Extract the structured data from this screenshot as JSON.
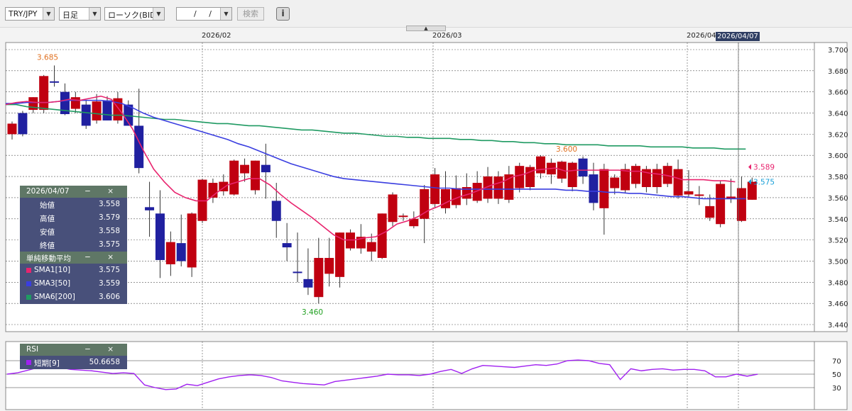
{
  "toolbar": {
    "symbol": "TRY/JPY",
    "timeframe": "日足",
    "chart_style": "ローソク(BID)",
    "date_input": "/ /",
    "search_label": "検索",
    "info_icon": "info-circle-icon",
    "collapse_icon": "triangle-up-icon"
  },
  "current_date_label": "2026/04/07",
  "ohlc_panel": {
    "title": "2026/04/07",
    "controls": "− ×",
    "rows": [
      {
        "label": "始値",
        "value": "3.558"
      },
      {
        "label": "高値",
        "value": "3.579"
      },
      {
        "label": "安値",
        "value": "3.558"
      },
      {
        "label": "終値",
        "value": "3.575"
      }
    ]
  },
  "sma_panel": {
    "title": "単純移動平均",
    "controls": "− ×",
    "rows": [
      {
        "label": "SMA1[10]",
        "value": "3.575",
        "color": "#e8246e"
      },
      {
        "label": "SMA3[50]",
        "value": "3.559",
        "color": "#3a3ee0"
      },
      {
        "label": "SMA6[200]",
        "value": "3.606",
        "color": "#1f9a62"
      }
    ]
  },
  "rsi_panel": {
    "title": "RSI",
    "controls": "− ×",
    "rows": [
      {
        "label": "短期[9]",
        "value": "50.6658",
        "color": "#a020f0"
      }
    ]
  },
  "colors": {
    "up": "#c00010",
    "down": "#2020a0",
    "sma10": "#e8246e",
    "sma50": "#3a3ee0",
    "sma200": "#1f9a62",
    "rsi": "#a020f0",
    "high_label": "#e07020",
    "low_label": "#20a020",
    "last_price": "#e8246e",
    "sma_price": "#1aa0d8"
  },
  "chart_data": {
    "type": "candlestick",
    "x_labels": [
      "2026/02",
      "2026/03",
      "2026/04"
    ],
    "ylim": [
      3.44,
      3.7
    ],
    "yticks": [
      "3.700",
      "3.680",
      "3.660",
      "3.640",
      "3.620",
      "3.600",
      "3.580",
      "3.560",
      "3.540",
      "3.520",
      "3.500",
      "3.480",
      "3.460",
      "3.440"
    ],
    "candles": [
      {
        "o": 3.62,
        "h": 3.632,
        "l": 3.615,
        "c": 3.63
      },
      {
        "o": 3.64,
        "h": 3.642,
        "l": 3.618,
        "c": 3.62
      },
      {
        "o": 3.643,
        "h": 3.655,
        "l": 3.64,
        "c": 3.655
      },
      {
        "o": 3.643,
        "h": 3.676,
        "l": 3.64,
        "c": 3.675
      },
      {
        "o": 3.67,
        "h": 3.685,
        "l": 3.665,
        "c": 3.669
      },
      {
        "o": 3.66,
        "h": 3.668,
        "l": 3.638,
        "c": 3.639
      },
      {
        "o": 3.644,
        "h": 3.66,
        "l": 3.64,
        "c": 3.655
      },
      {
        "o": 3.648,
        "h": 3.652,
        "l": 3.625,
        "c": 3.628
      },
      {
        "o": 3.633,
        "h": 3.658,
        "l": 3.63,
        "c": 3.651
      },
      {
        "o": 3.652,
        "h": 3.656,
        "l": 3.633,
        "c": 3.633
      },
      {
        "o": 3.633,
        "h": 3.66,
        "l": 3.63,
        "c": 3.654
      },
      {
        "o": 3.648,
        "h": 3.652,
        "l": 3.628,
        "c": 3.628
      },
      {
        "o": 3.628,
        "h": 3.663,
        "l": 3.583,
        "c": 3.588
      },
      {
        "o": 3.551,
        "h": 3.575,
        "l": 3.523,
        "c": 3.548
      },
      {
        "o": 3.545,
        "h": 3.567,
        "l": 3.484,
        "c": 3.501
      },
      {
        "o": 3.497,
        "h": 3.528,
        "l": 3.486,
        "c": 3.518
      },
      {
        "o": 3.517,
        "h": 3.544,
        "l": 3.495,
        "c": 3.5
      },
      {
        "o": 3.494,
        "h": 3.546,
        "l": 3.485,
        "c": 3.545
      },
      {
        "o": 3.538,
        "h": 3.578,
        "l": 3.536,
        "c": 3.577
      },
      {
        "o": 3.56,
        "h": 3.578,
        "l": 3.555,
        "c": 3.574
      },
      {
        "o": 3.566,
        "h": 3.582,
        "l": 3.562,
        "c": 3.575
      },
      {
        "o": 3.563,
        "h": 3.596,
        "l": 3.562,
        "c": 3.595
      },
      {
        "o": 3.583,
        "h": 3.597,
        "l": 3.575,
        "c": 3.591
      },
      {
        "o": 3.567,
        "h": 3.595,
        "l": 3.563,
        "c": 3.595
      },
      {
        "o": 3.591,
        "h": 3.611,
        "l": 3.559,
        "c": 3.584
      },
      {
        "o": 3.557,
        "h": 3.574,
        "l": 3.522,
        "c": 3.538
      },
      {
        "o": 3.517,
        "h": 3.536,
        "l": 3.5,
        "c": 3.513
      },
      {
        "o": 3.49,
        "h": 3.527,
        "l": 3.48,
        "c": 3.489
      },
      {
        "o": 3.483,
        "h": 3.512,
        "l": 3.468,
        "c": 3.475
      },
      {
        "o": 3.466,
        "h": 3.522,
        "l": 3.46,
        "c": 3.503
      },
      {
        "o": 3.488,
        "h": 3.522,
        "l": 3.476,
        "c": 3.503
      },
      {
        "o": 3.485,
        "h": 3.527,
        "l": 3.475,
        "c": 3.527
      },
      {
        "o": 3.512,
        "h": 3.53,
        "l": 3.51,
        "c": 3.527
      },
      {
        "o": 3.512,
        "h": 3.535,
        "l": 3.507,
        "c": 3.523
      },
      {
        "o": 3.509,
        "h": 3.526,
        "l": 3.5,
        "c": 3.518
      },
      {
        "o": 3.503,
        "h": 3.545,
        "l": 3.502,
        "c": 3.545
      },
      {
        "o": 3.537,
        "h": 3.565,
        "l": 3.533,
        "c": 3.563
      },
      {
        "o": 3.543,
        "h": 3.545,
        "l": 3.538,
        "c": 3.543
      },
      {
        "o": 3.533,
        "h": 3.547,
        "l": 3.531,
        "c": 3.54
      },
      {
        "o": 3.54,
        "h": 3.572,
        "l": 3.517,
        "c": 3.568
      },
      {
        "o": 3.554,
        "h": 3.588,
        "l": 3.55,
        "c": 3.582
      },
      {
        "o": 3.55,
        "h": 3.585,
        "l": 3.545,
        "c": 3.568
      },
      {
        "o": 3.553,
        "h": 3.581,
        "l": 3.55,
        "c": 3.569
      },
      {
        "o": 3.559,
        "h": 3.583,
        "l": 3.553,
        "c": 3.57
      },
      {
        "o": 3.557,
        "h": 3.585,
        "l": 3.555,
        "c": 3.574
      },
      {
        "o": 3.559,
        "h": 3.589,
        "l": 3.555,
        "c": 3.58
      },
      {
        "o": 3.559,
        "h": 3.585,
        "l": 3.554,
        "c": 3.58
      },
      {
        "o": 3.558,
        "h": 3.59,
        "l": 3.555,
        "c": 3.582
      },
      {
        "o": 3.569,
        "h": 3.593,
        "l": 3.565,
        "c": 3.59
      },
      {
        "o": 3.57,
        "h": 3.591,
        "l": 3.567,
        "c": 3.589
      },
      {
        "o": 3.583,
        "h": 3.6,
        "l": 3.578,
        "c": 3.599
      },
      {
        "o": 3.582,
        "h": 3.597,
        "l": 3.573,
        "c": 3.593
      },
      {
        "o": 3.578,
        "h": 3.595,
        "l": 3.574,
        "c": 3.594
      },
      {
        "o": 3.57,
        "h": 3.594,
        "l": 3.566,
        "c": 3.593
      },
      {
        "o": 3.597,
        "h": 3.599,
        "l": 3.573,
        "c": 3.58
      },
      {
        "o": 3.582,
        "h": 3.593,
        "l": 3.548,
        "c": 3.555
      },
      {
        "o": 3.55,
        "h": 3.592,
        "l": 3.525,
        "c": 3.587
      },
      {
        "o": 3.569,
        "h": 3.582,
        "l": 3.563,
        "c": 3.579
      },
      {
        "o": 3.567,
        "h": 3.592,
        "l": 3.564,
        "c": 3.587
      },
      {
        "o": 3.573,
        "h": 3.592,
        "l": 3.569,
        "c": 3.59
      },
      {
        "o": 3.57,
        "h": 3.59,
        "l": 3.565,
        "c": 3.587
      },
      {
        "o": 3.57,
        "h": 3.592,
        "l": 3.564,
        "c": 3.587
      },
      {
        "o": 3.573,
        "h": 3.593,
        "l": 3.57,
        "c": 3.59
      },
      {
        "o": 3.562,
        "h": 3.596,
        "l": 3.559,
        "c": 3.587
      },
      {
        "o": 3.563,
        "h": 3.586,
        "l": 3.561,
        "c": 3.566
      },
      {
        "o": 3.563,
        "h": 3.571,
        "l": 3.553,
        "c": 3.563
      },
      {
        "o": 3.541,
        "h": 3.563,
        "l": 3.538,
        "c": 3.552
      },
      {
        "o": 3.535,
        "h": 3.576,
        "l": 3.532,
        "c": 3.573
      },
      {
        "o": 3.559,
        "h": 3.578,
        "l": 3.555,
        "c": 3.561
      },
      {
        "o": 3.538,
        "h": 3.58,
        "l": 3.537,
        "c": 3.569
      },
      {
        "o": 3.558,
        "h": 3.579,
        "l": 3.558,
        "c": 3.575
      }
    ],
    "sma10": [
      3.648,
      3.65,
      3.651,
      3.65,
      3.65,
      3.651,
      3.653,
      3.652,
      3.654,
      3.656,
      3.653,
      3.64,
      3.625,
      3.605,
      3.587,
      3.575,
      3.565,
      3.56,
      3.557,
      3.557,
      3.565,
      3.572,
      3.575,
      3.578,
      3.578,
      3.572,
      3.563,
      3.555,
      3.548,
      3.541,
      3.533,
      3.525,
      3.52,
      3.52,
      3.522,
      3.523,
      3.528,
      3.535,
      3.538,
      3.542,
      3.548,
      3.552,
      3.557,
      3.561,
      3.564,
      3.568,
      3.572,
      3.575,
      3.58,
      3.582,
      3.586,
      3.587,
      3.588,
      3.585,
      3.586,
      3.586,
      3.586,
      3.586,
      3.586,
      3.585,
      3.585,
      3.583,
      3.582,
      3.58,
      3.577,
      3.577,
      3.577,
      3.576,
      3.576,
      3.575
    ],
    "sma50": [
      3.649,
      3.649,
      3.65,
      3.65,
      3.65,
      3.651,
      3.652,
      3.652,
      3.652,
      3.652,
      3.651,
      3.649,
      3.645,
      3.64,
      3.636,
      3.633,
      3.63,
      3.627,
      3.624,
      3.621,
      3.618,
      3.615,
      3.611,
      3.608,
      3.604,
      3.6,
      3.596,
      3.592,
      3.589,
      3.586,
      3.583,
      3.58,
      3.578,
      3.577,
      3.576,
      3.575,
      3.574,
      3.573,
      3.572,
      3.571,
      3.57,
      3.569,
      3.569,
      3.568,
      3.568,
      3.568,
      3.568,
      3.568,
      3.568,
      3.568,
      3.568,
      3.568,
      3.568,
      3.567,
      3.567,
      3.566,
      3.566,
      3.565,
      3.565,
      3.564,
      3.564,
      3.563,
      3.562,
      3.561,
      3.561,
      3.56,
      3.559,
      3.559,
      3.559,
      3.559,
      3.559
    ],
    "sma200": [
      3.648,
      3.648,
      3.646,
      3.645,
      3.644,
      3.643,
      3.642,
      3.641,
      3.64,
      3.639,
      3.638,
      3.638,
      3.637,
      3.636,
      3.635,
      3.634,
      3.634,
      3.633,
      3.632,
      3.631,
      3.63,
      3.63,
      3.629,
      3.628,
      3.628,
      3.627,
      3.626,
      3.625,
      3.624,
      3.624,
      3.623,
      3.622,
      3.621,
      3.621,
      3.62,
      3.619,
      3.618,
      3.618,
      3.617,
      3.617,
      3.616,
      3.616,
      3.616,
      3.615,
      3.615,
      3.614,
      3.614,
      3.613,
      3.613,
      3.612,
      3.612,
      3.611,
      3.611,
      3.61,
      3.61,
      3.61,
      3.61,
      3.609,
      3.609,
      3.609,
      3.609,
      3.608,
      3.608,
      3.608,
      3.608,
      3.607,
      3.607,
      3.607,
      3.606,
      3.606,
      3.606
    ],
    "rsi": [
      50,
      52,
      56,
      60,
      64,
      60,
      57,
      56,
      55,
      53,
      51,
      52,
      51,
      34,
      30,
      27,
      28,
      35,
      33,
      38,
      43,
      46,
      48,
      49,
      48,
      45,
      40,
      38,
      36,
      35,
      34,
      39,
      41,
      43,
      45,
      47,
      50,
      49,
      49,
      48,
      50,
      54,
      57,
      51,
      58,
      63,
      62,
      61,
      60,
      62,
      64,
      63,
      65,
      70,
      71,
      70,
      66,
      64,
      42,
      58,
      55,
      57,
      58,
      56,
      57,
      57,
      55,
      46,
      46,
      50,
      47,
      50
    ],
    "rsi_ticks": [
      "70",
      "50",
      "30"
    ],
    "annotations": [
      {
        "text": "3.685",
        "y": 3.685,
        "color": "#e07020"
      },
      {
        "text": "3.460",
        "y": 3.46,
        "color": "#20a020"
      },
      {
        "text": "3.600",
        "y": 3.6,
        "color": "#e07020"
      }
    ],
    "price_tags": [
      {
        "text": "3.589",
        "y": 3.589,
        "color": "#e8246e"
      },
      {
        "text": "3.575",
        "y": 3.575,
        "color": "#1aa0d8"
      }
    ]
  }
}
